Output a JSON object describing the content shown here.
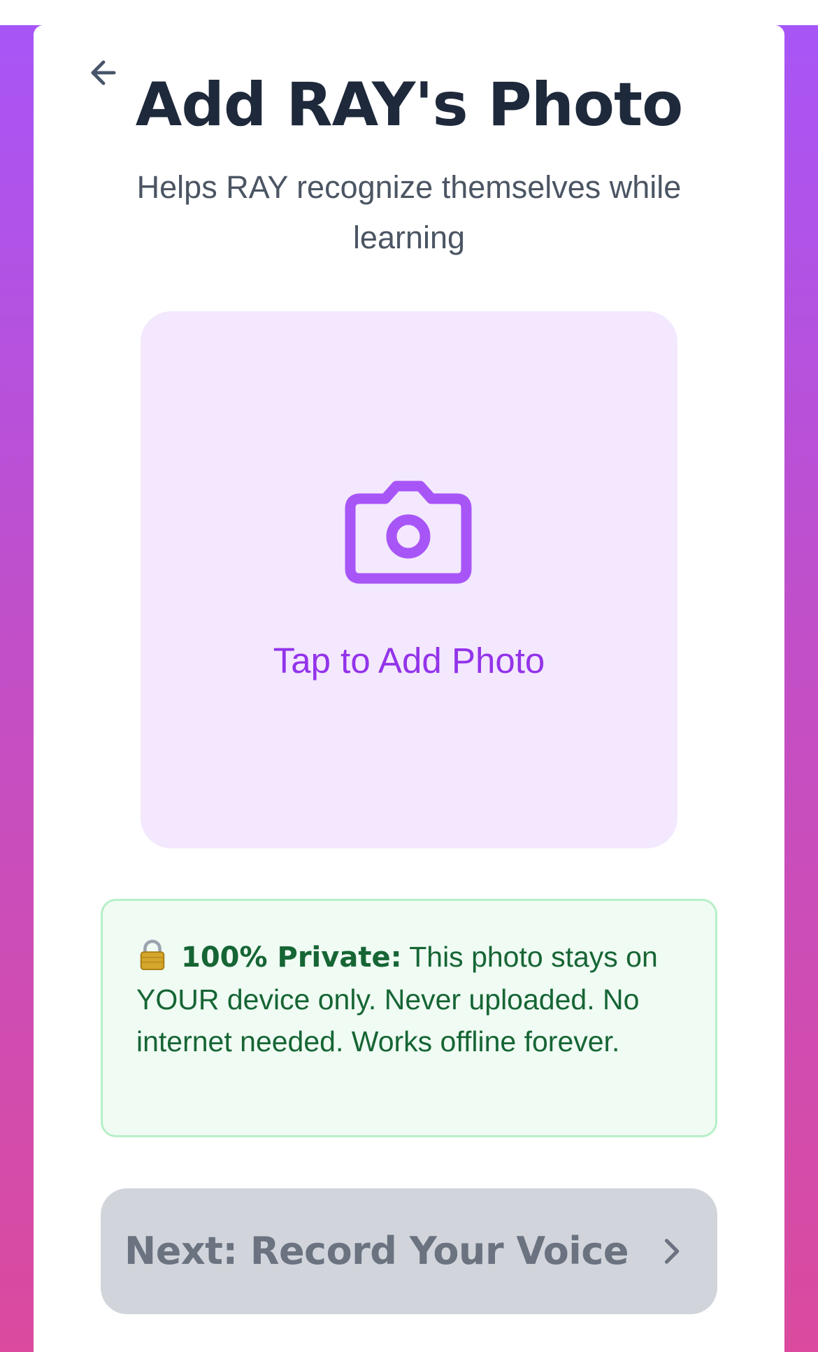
{
  "header": {
    "title": "Add RAY's Photo",
    "subtitle": "Helps RAY recognize themselves while learning"
  },
  "photo_picker": {
    "label": "Tap to Add Photo",
    "icon": "camera-icon"
  },
  "privacy_notice": {
    "icon": "lock-icon",
    "strong": "100% Private:",
    "text": " This photo stays on YOUR device only. Never uploaded. No internet needed. Works offline forever."
  },
  "next_button": {
    "label": "Next: Record Your Voice",
    "icon": "chevron-right-icon"
  },
  "colors": {
    "accent": "#9333ea",
    "photo_bg": "#f3e8fd",
    "privacy_text": "#166534",
    "privacy_bg": "#effbf3",
    "button_disabled_bg": "#d1d5db",
    "title": "#1e293b"
  }
}
